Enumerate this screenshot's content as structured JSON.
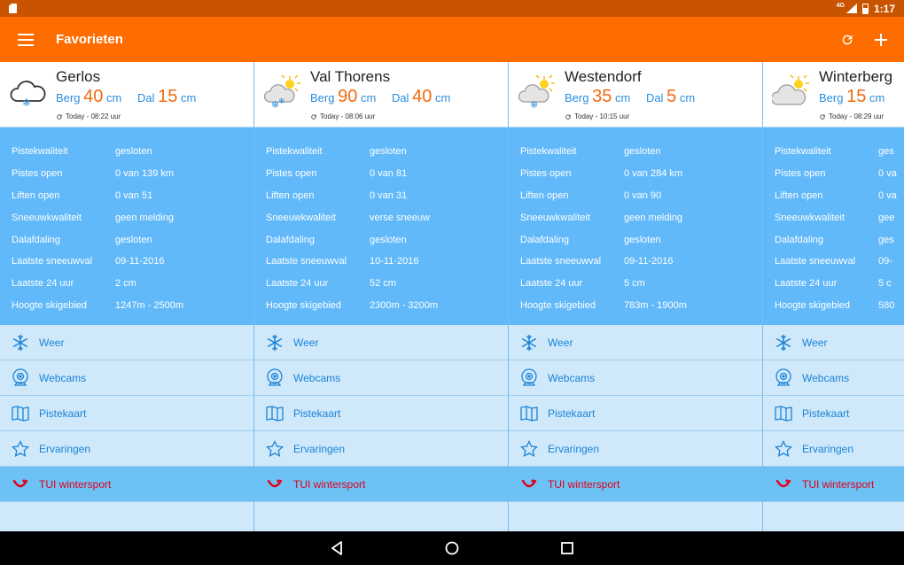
{
  "status": {
    "network": "4G",
    "time": "1:17"
  },
  "appbar": {
    "title": "Favorieten"
  },
  "labels": {
    "berg": "Berg",
    "dal": "Dal",
    "unit": "cm",
    "stats": [
      "Pistekwaliteit",
      "Pistes open",
      "Liften open",
      "Sneeuwkwaliteit",
      "Dalafdaling",
      "Laatste sneeuwval",
      "Laatste 24 uur",
      "Hoogte skigebied"
    ]
  },
  "links": [
    {
      "label": "Weer",
      "icon": "snowflake-icon"
    },
    {
      "label": "Webcams",
      "icon": "webcam-icon"
    },
    {
      "label": "Pistekaart",
      "icon": "map-icon"
    },
    {
      "label": "Ervaringen",
      "icon": "star-icon"
    },
    {
      "label": "TUI wintersport",
      "icon": "tui-logo-icon"
    }
  ],
  "colors": {
    "appbar": "#ff6d00",
    "statusbar": "#c95400",
    "stats_bg": "#61b9fa",
    "link_bg": "#cfe8fa",
    "tui_bg": "#6cc2f5",
    "snow_num": "#f26a10",
    "link_text": "#1a84d6",
    "tui_text": "#e2001a"
  },
  "cards": [
    {
      "name": "Gerlos",
      "weather_icon": "cloud-snow-icon",
      "berg": "40",
      "dal": "15",
      "updated": "Today - 08:22 uur",
      "stats": [
        "gesloten",
        "0 van 139 km",
        "0 van 51",
        "geen melding",
        "gesloten",
        "09-11-2016",
        "2 cm",
        "1247m - 2500m"
      ]
    },
    {
      "name": "Val Thorens",
      "weather_icon": "sun-cloud-snow-icon",
      "berg": "90",
      "dal": "40",
      "updated": "Today - 08:06 uur",
      "stats": [
        "gesloten",
        "0 van 81",
        "0 van 31",
        "verse sneeuw",
        "gesloten",
        "10-11-2016",
        "52 cm",
        "2300m - 3200m"
      ]
    },
    {
      "name": "Westendorf",
      "weather_icon": "sun-cloud-snow-icon",
      "berg": "35",
      "dal": "5",
      "updated": "Today - 10:15 uur",
      "stats": [
        "gesloten",
        "0 van 284 km",
        "0 van 90",
        "geen melding",
        "gesloten",
        "09-11-2016",
        "5 cm",
        "783m - 1900m"
      ]
    },
    {
      "name": "Winterberg",
      "weather_icon": "sun-cloud-icon",
      "berg": "15",
      "dal": "",
      "updated": "Today - 08:29 uur",
      "stats": [
        "ges",
        "0 va",
        "0 va",
        "gee",
        "ges",
        "09-",
        "5 c",
        "580"
      ]
    }
  ]
}
